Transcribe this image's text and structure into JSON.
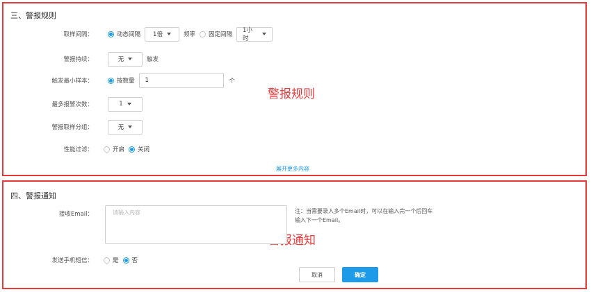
{
  "rules": {
    "title": "三、警报规则",
    "watermark": "警报规则",
    "sampling": {
      "label": "取样间隔：",
      "dynamic": "动态间隔",
      "multiplier": "1倍",
      "freq": "频率",
      "fixed": "固定间隔",
      "fixed_value": "1小时"
    },
    "duration": {
      "label": "警报持续：",
      "value": "无",
      "suffix": "触发"
    },
    "min_sample": {
      "label": "触发最小样本：",
      "option": "按数量",
      "value": "1",
      "unit": "个"
    },
    "max_alerts": {
      "label": "最多报警次数：",
      "value": "1"
    },
    "grouping": {
      "label": "警报取样分组：",
      "value": "无"
    },
    "perf_filter": {
      "label": "性能过滤：",
      "on": "开启",
      "off": "关闭"
    },
    "expand_link": "展开更多内容"
  },
  "notify": {
    "title": "四、警报通知",
    "watermark": "警报通知",
    "email": {
      "label": "接收Email：",
      "placeholder": "请输入内容",
      "hint": "注：当需要录入多个Email时，可以在输入完一个后回车输入下一个Email。"
    },
    "sms": {
      "label": "发送手机短信：",
      "yes": "是",
      "no": "否"
    },
    "cancel": "取消",
    "confirm": "确定"
  },
  "colors": {
    "accent": "#1d9be8",
    "annotation": "#e23b3b"
  }
}
